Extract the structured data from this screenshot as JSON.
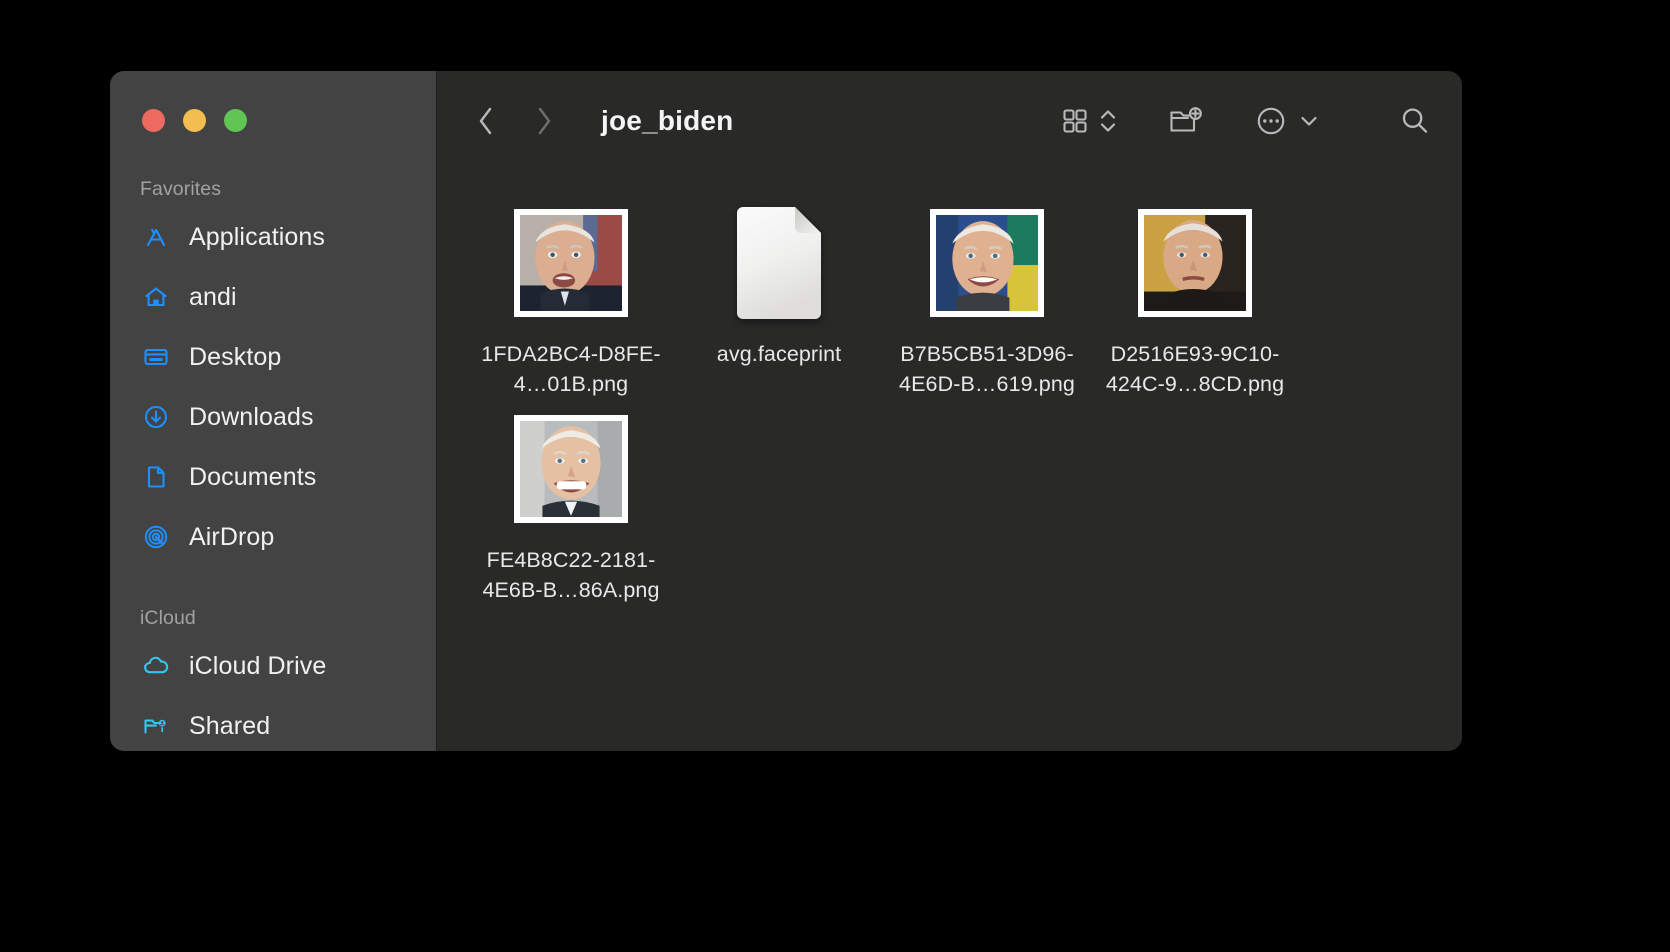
{
  "window": {
    "traffic_lights": [
      {
        "name": "close",
        "color": "#ec6a5f"
      },
      {
        "name": "minimize",
        "color": "#f4bd4f"
      },
      {
        "name": "maximize",
        "color": "#61c554"
      }
    ]
  },
  "sidebar": {
    "sections": [
      {
        "title": "Favorites",
        "items": [
          {
            "label": "Applications",
            "icon": "applications-icon",
            "color": "#1e8fff"
          },
          {
            "label": "andi",
            "icon": "home-icon",
            "color": "#1e8fff"
          },
          {
            "label": "Desktop",
            "icon": "desktop-icon",
            "color": "#1e8fff"
          },
          {
            "label": "Downloads",
            "icon": "downloads-icon",
            "color": "#1e8fff"
          },
          {
            "label": "Documents",
            "icon": "documents-icon",
            "color": "#1e8fff"
          },
          {
            "label": "AirDrop",
            "icon": "airdrop-icon",
            "color": "#1e8fff"
          }
        ]
      },
      {
        "title": "iCloud",
        "items": [
          {
            "label": "iCloud Drive",
            "icon": "cloud-icon",
            "color": "#31c7f0"
          },
          {
            "label": "Shared",
            "icon": "shared-folder-icon",
            "color": "#31c7f0"
          }
        ]
      }
    ]
  },
  "toolbar": {
    "back_label": "Back",
    "forward_label": "Forward",
    "title": "joe_biden",
    "view_label": "Icon view",
    "new_folder_label": "New Folder",
    "more_label": "More",
    "search_label": "Search"
  },
  "files": [
    {
      "name": "1FDA2BC4-D8FE-4…01B.png",
      "kind": "photo",
      "thumb": {
        "style": "portrait-flag",
        "skin": "#d9a98d",
        "bg": "#b8b0a8",
        "accent": "#9b4a45"
      }
    },
    {
      "name": "avg.faceprint",
      "kind": "document",
      "thumb": {
        "style": "blank-document"
      }
    },
    {
      "name": "B7B5CB51-3D96-4E6D-B…619.png",
      "kind": "photo",
      "thumb": {
        "style": "portrait-smile",
        "skin": "#e0b190",
        "bg": "#2b4f8e",
        "accent": "#d8c43a"
      }
    },
    {
      "name": "D2516E93-9C10-424C-9…8CD.png",
      "kind": "photo",
      "thumb": {
        "style": "portrait-serious",
        "skin": "#d9a884",
        "bg": "#caa243",
        "accent": "#2a2420"
      }
    },
    {
      "name": "FE4B8C22-2181-4E6B-B…86A.png",
      "kind": "photo",
      "thumb": {
        "style": "portrait-grin",
        "skin": "#e6c0a2",
        "bg": "#b9bcbd",
        "accent": "#ffffff"
      }
    }
  ],
  "colors": {
    "window_bg": "#292928",
    "sidebar_bg": "#434343",
    "accent_blue": "#1e8fff",
    "accent_cyan": "#31c7f0",
    "text_primary": "#f1f1f1",
    "text_secondary": "#a2a2a2"
  }
}
